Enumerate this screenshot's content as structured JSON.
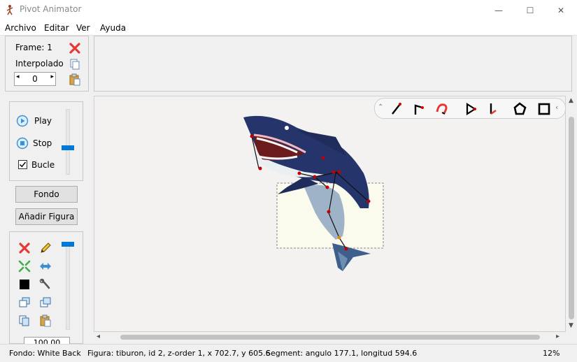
{
  "window": {
    "title": "Pivot Animator",
    "minimize_glyph": "—",
    "maximize_glyph": "☐",
    "close_glyph": "✕"
  },
  "menu": [
    "Archivo",
    "Editar",
    "Ver",
    "Ayuda"
  ],
  "frame_panel": {
    "frame_label": "Frame: 1",
    "interp_label": "Interpolado",
    "interp_value": "0",
    "icons": [
      "delete-frame-icon",
      "copy-frame-icon",
      "paste-frame-icon"
    ]
  },
  "playback": {
    "play_label": "Play",
    "stop_label": "Stop",
    "loop_label": "Bucle",
    "loop_checked": true,
    "speed_level": 0.4
  },
  "buttons": {
    "background_label": "Fondo",
    "add_figure_label": "Añadir Figura"
  },
  "figure_tools": {
    "icons": [
      "delete-icon",
      "pencil-icon",
      "center-icon",
      "flip-icon",
      "color-icon",
      "wrench-icon",
      "bring-front-icon",
      "send-back-icon",
      "copy-icon",
      "paste-icon"
    ],
    "scale_value": "100.00",
    "opacity_level": 1.0
  },
  "floating_toolbar": {
    "icons": [
      "line-segment-icon",
      "bent-segment-icon",
      "curve-segment-icon",
      "triangle-segment-icon",
      "join-segment-icon",
      "polygon-icon",
      "square-icon"
    ]
  },
  "status": {
    "background": "Fondo: White Back",
    "figure": "Figura: tiburon,  id 2,  z-order 1,  x 702.7, y 605.6",
    "segment": "Segment: angulo 177.1,  longitud 594.6",
    "zoom": "12%"
  },
  "colors": {
    "accent": "#0078d7",
    "delete": "#e53935",
    "shark_body": "#25346b",
    "shark_belly": "#9fb3c8",
    "joint": "#c00000"
  }
}
